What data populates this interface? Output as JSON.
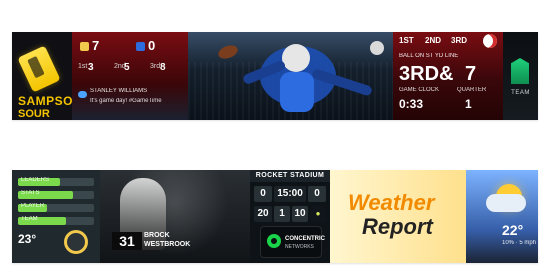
{
  "top": {
    "sponsor": {
      "brand_top": "SAMPSON",
      "brand_bottom": "SOUR SODAS"
    },
    "scoreboard": {
      "home_score": "7",
      "away_score": "0",
      "stats": [
        {
          "label": "1st",
          "value": "3"
        },
        {
          "label": "2nd",
          "value": "5"
        },
        {
          "label": "3rd",
          "value": "8"
        }
      ],
      "tweet_name": "STANLEY WILLIAMS",
      "tweet_text": "It's game day! #GameTime"
    },
    "game_info": {
      "top_left": "1ST",
      "top_mid": "2ND",
      "top_right": "3RD",
      "ball_line": "BALL ON ST YD LINE",
      "down": "3RD",
      "amp": "&",
      "distance": "7",
      "game_clock_label": "GAME CLOCK",
      "game_clock_value": "0:33",
      "quarter_label": "QUARTER",
      "quarter_value": "1"
    },
    "logo_text": "TEAM"
  },
  "bottom": {
    "team_stats": {
      "bars": [
        {
          "label": "LEADERS",
          "fill": 0.55
        },
        {
          "label": "STATS",
          "fill": 0.72
        },
        {
          "label": "PLAYER",
          "fill": 0.38
        },
        {
          "label": "TEAM",
          "fill": 0.63
        }
      ],
      "temp": "23°"
    },
    "player": {
      "number": "31",
      "first": "BROCK",
      "last": "WESTBROOK"
    },
    "stadium_clock": {
      "header": "ROCKET STADIUM",
      "row1": [
        "0",
        "15:00",
        "0"
      ],
      "row2": [
        "20",
        "1",
        "10"
      ],
      "sponsor_name": "CONCENTRIC",
      "sponsor_sub": "NETWORKS"
    },
    "weather": {
      "title_line1": "Weather",
      "title_line2": "Report",
      "temp": "22°",
      "small": "10% · 5 mph"
    }
  }
}
